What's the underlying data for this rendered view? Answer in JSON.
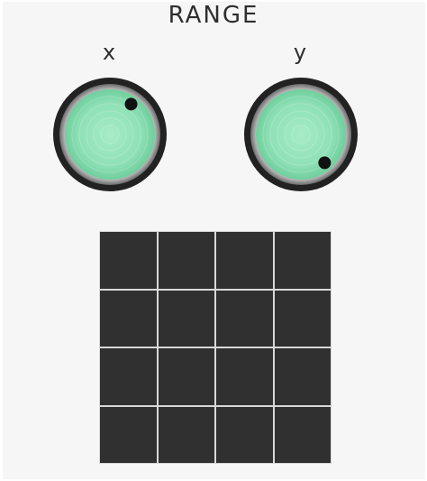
{
  "title": "RANGE",
  "knobs": [
    {
      "label": "x",
      "icon": "knob-dial-icon",
      "indicator_angle_deg": 35
    },
    {
      "label": "y",
      "icon": "knob-dial-icon",
      "indicator_angle_deg": 140
    }
  ],
  "grid": {
    "rows": 4,
    "columns": 4
  },
  "colors": {
    "knob_face": "#8fe0b6",
    "knob_rim": "#222222",
    "indicator": "#111111",
    "cell": "#303030"
  }
}
